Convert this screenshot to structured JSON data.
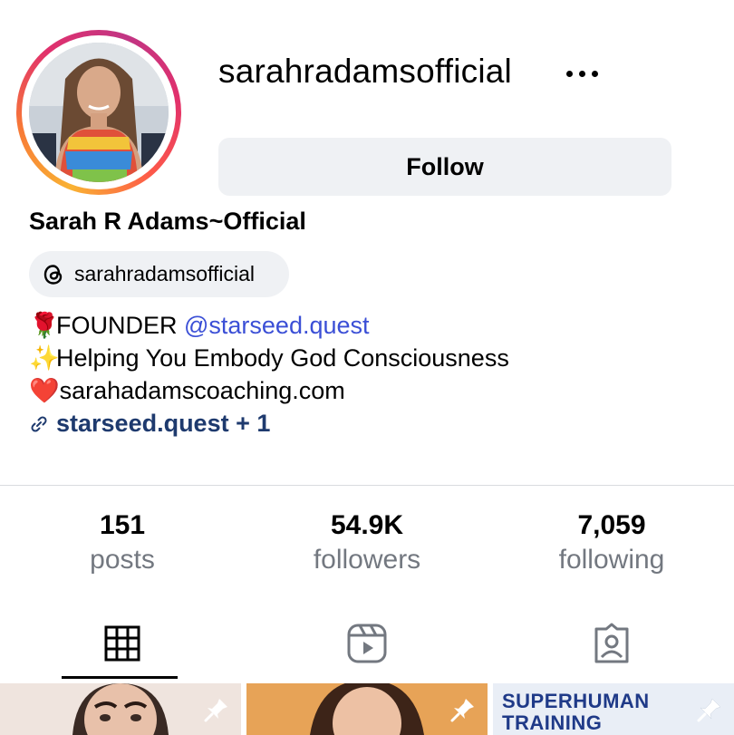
{
  "profile": {
    "username": "sarahradamsofficial",
    "full_name": "Sarah R Adams~Official",
    "follow_label": "Follow",
    "threads_handle": "sarahradamsofficial",
    "avatar_icon": "profile-photo"
  },
  "bio": {
    "line1_emoji": "🌹",
    "line1_text": "FOUNDER ",
    "line1_mention": "@starseed.quest",
    "line2_emoji": "✨",
    "line2_text": "Helping You Embody God Consciousness",
    "line3_emoji": "❤️",
    "line3_text": "sarahadamscoaching.com",
    "link_text": "starseed.quest + 1"
  },
  "stats": {
    "posts_count": "151",
    "posts_label": "posts",
    "followers_count": "54.9K",
    "followers_label": "followers",
    "following_count": "7,059",
    "following_label": "following"
  },
  "tabs": [
    {
      "name": "grid",
      "icon": "grid-icon",
      "active": true
    },
    {
      "name": "reels",
      "icon": "reels-icon",
      "active": false
    },
    {
      "name": "tagged",
      "icon": "tagged-icon",
      "active": false
    }
  ],
  "posts": [
    {
      "pinned": true,
      "icon": "pin-icon"
    },
    {
      "pinned": true,
      "icon": "pin-icon"
    },
    {
      "pinned": true,
      "icon": "pin-icon",
      "text_line1": "SUPERHUMAN",
      "text_line2": "TRAINING"
    }
  ],
  "colors": {
    "mention": "#3b4fd6",
    "link": "#1e3a6e",
    "button_bg": "#eff1f4",
    "muted": "#737880"
  }
}
